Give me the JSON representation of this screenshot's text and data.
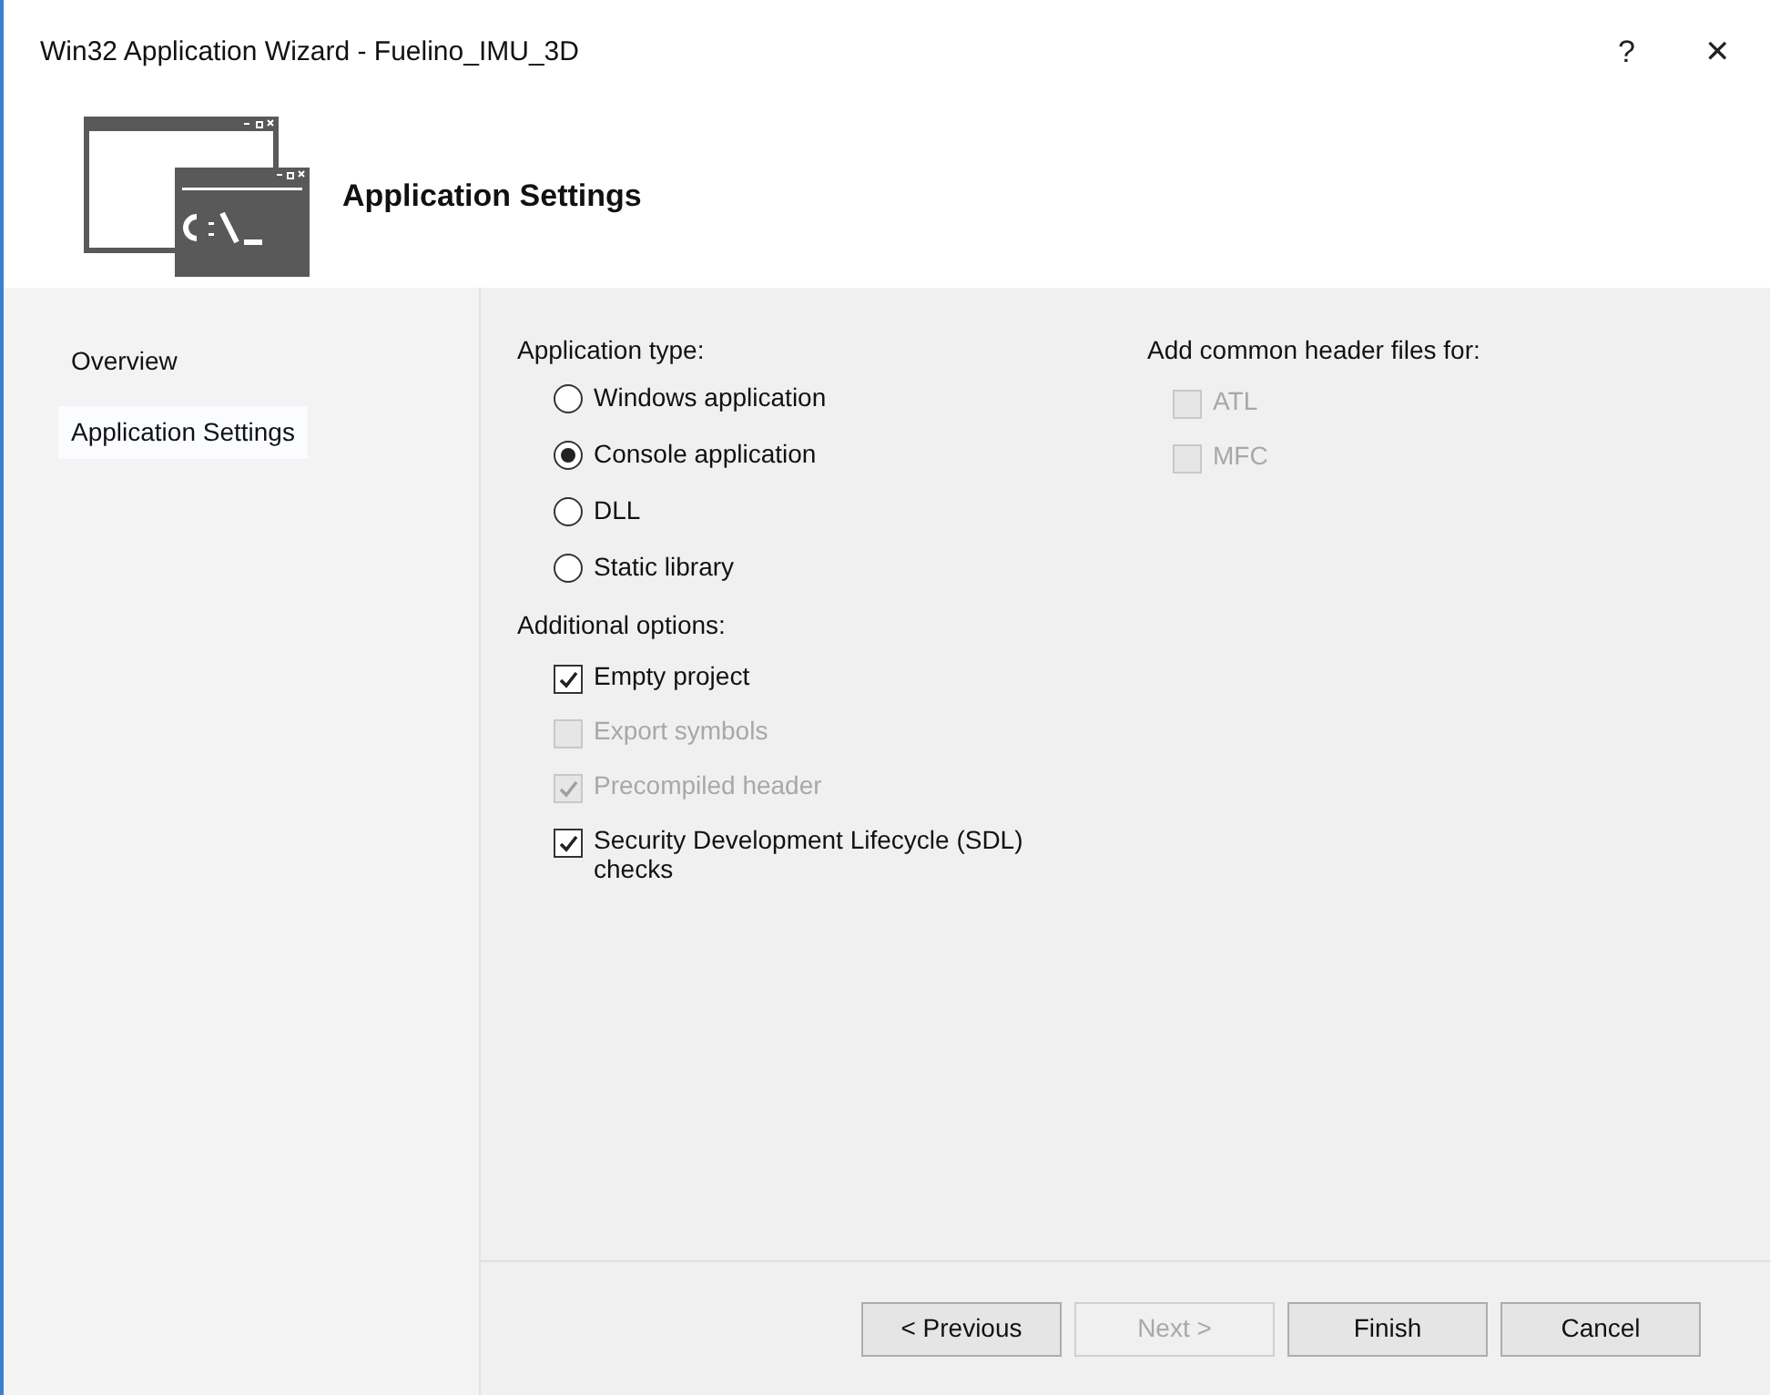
{
  "window": {
    "title": "Win32 Application Wizard - Fuelino_IMU_3D",
    "title_buttons": [
      "?",
      "✕"
    ]
  },
  "header": {
    "title": "Application Settings"
  },
  "sidebar": {
    "items": [
      {
        "label": "Overview",
        "selected": false
      },
      {
        "label": "Application Settings",
        "selected": true
      }
    ]
  },
  "application_type": {
    "label": "Application type:",
    "options": [
      {
        "label": "Windows application",
        "selected": false
      },
      {
        "label": "Console application",
        "selected": true
      },
      {
        "label": "DLL",
        "selected": false
      },
      {
        "label": "Static library",
        "selected": false
      }
    ]
  },
  "additional_options": {
    "label": "Additional options:",
    "options": [
      {
        "label": "Empty project",
        "checked": true,
        "disabled": false
      },
      {
        "label": "Export symbols",
        "checked": false,
        "disabled": true
      },
      {
        "label": "Precompiled header",
        "checked": true,
        "disabled": true
      },
      {
        "label": "Security Development Lifecycle (SDL) checks",
        "checked": true,
        "disabled": false
      }
    ]
  },
  "common_headers": {
    "label": "Add common header files for:",
    "options": [
      {
        "label": "ATL",
        "checked": false,
        "disabled": true
      },
      {
        "label": "MFC",
        "checked": false,
        "disabled": true
      }
    ]
  },
  "buttons": [
    {
      "label": "< Previous",
      "disabled": false
    },
    {
      "label": "Next >",
      "disabled": true
    },
    {
      "label": "Finish",
      "disabled": false
    },
    {
      "label": "Cancel",
      "disabled": false
    }
  ]
}
